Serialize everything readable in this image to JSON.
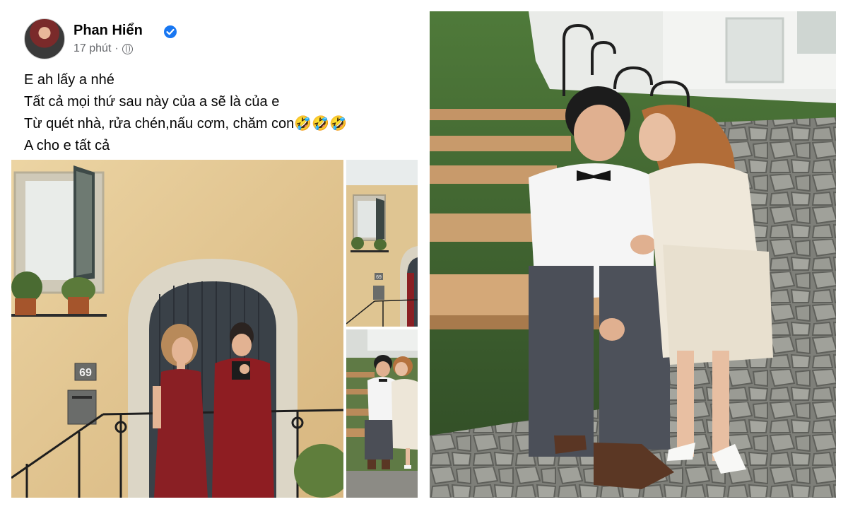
{
  "post": {
    "author": "Phan Hiển",
    "time": "17 phút",
    "separator": "·",
    "lines": [
      "E ah lấy a nhé",
      "Tất cả mọi thứ sau này của a sẽ là của e",
      "Từ quét nhà, rửa chén,nấu cơm, chăm con🤣🤣🤣",
      "A cho e tất cả"
    ],
    "photos": {
      "main_door_number": "69",
      "thumb_door_number": "69"
    }
  },
  "icons": {
    "verified": "verified-badge-icon",
    "audience": "globe-icon"
  },
  "colors": {
    "verified": "#1877f2",
    "meta_text": "#65676b",
    "wall": "#e8cc98",
    "dress": "#8a1f24"
  }
}
